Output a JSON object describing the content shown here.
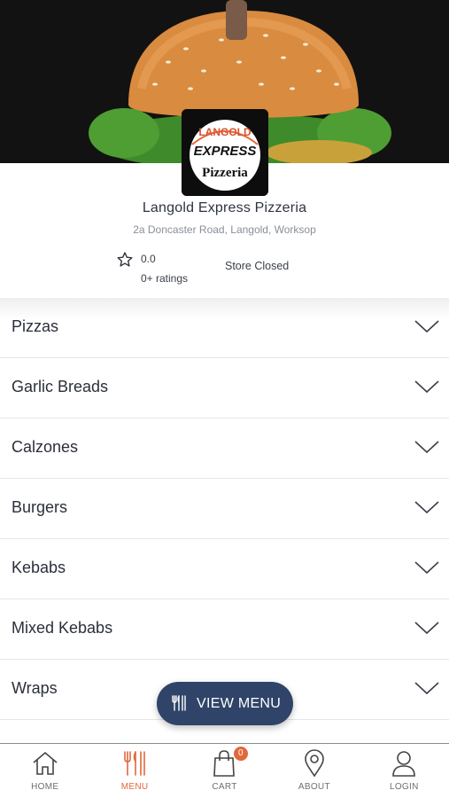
{
  "store": {
    "name": "Langold Express Pizzeria",
    "address": "2a Doncaster Road, Langold, Worksop",
    "rating": "0.0",
    "ratings_count": "0+ ratings",
    "status": "Store Closed",
    "logo_text": [
      "LANGOLD",
      "EXPRESS",
      "Pizzeria"
    ]
  },
  "menu": {
    "categories": [
      {
        "label": "Pizzas"
      },
      {
        "label": "Garlic Breads"
      },
      {
        "label": "Calzones"
      },
      {
        "label": "Burgers"
      },
      {
        "label": "Kebabs"
      },
      {
        "label": "Mixed Kebabs"
      },
      {
        "label": "Wraps"
      }
    ]
  },
  "view_menu_button": {
    "label": "VIEW MENU",
    "icon": "cutlery-icon"
  },
  "bottom_nav": {
    "items": [
      {
        "label": "HOME",
        "icon": "home-icon"
      },
      {
        "label": "MENU",
        "icon": "cutlery-icon",
        "active": true
      },
      {
        "label": "CART",
        "icon": "shopping-bag-icon",
        "badge": "0"
      },
      {
        "label": "ABOUT",
        "icon": "location-pin-icon"
      },
      {
        "label": "LOGIN",
        "icon": "user-icon"
      }
    ]
  },
  "colors": {
    "accent": "#e0683b",
    "button_bg": "#2f4468",
    "text": "#2b2f3a",
    "muted": "#8a8f98"
  }
}
